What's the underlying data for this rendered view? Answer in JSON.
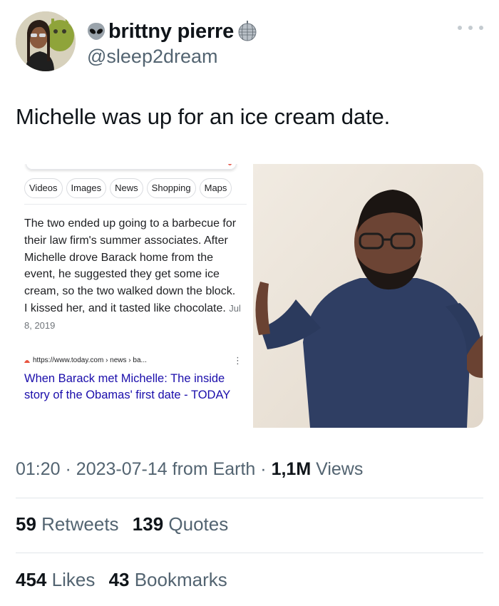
{
  "author": {
    "name": "brittny pierre",
    "handle": "@sleep2dream",
    "name_prefix_icon": "alien-icon",
    "name_suffix_icon": "disco-ball-icon"
  },
  "tweet": {
    "text": "Michelle was up for an ice cream date."
  },
  "google_result": {
    "chips": [
      "Videos",
      "Images",
      "News",
      "Shopping",
      "Maps"
    ],
    "snippet": "The two ended up going to a barbecue for their law firm's summer associates. After Michelle drove Barack home from the event, he suggested they get some ice cream, so the two walked down the block. I kissed her, and it tasted like chocolate.",
    "date": "Jul 8, 2019",
    "url": "https://www.today.com › news › ba...",
    "title": "When Barack met Michelle: The inside story of the Obamas' first date - TODAY"
  },
  "meta": {
    "time": "01:20",
    "date": "2023-07-14",
    "source": "from Earth",
    "views_count": "1,1M",
    "views_label": "Views"
  },
  "stats": {
    "retweets_count": "59",
    "retweets_label": "Retweets",
    "quotes_count": "139",
    "quotes_label": "Quotes",
    "likes_count": "454",
    "likes_label": "Likes",
    "bookmarks_count": "43",
    "bookmarks_label": "Bookmarks"
  },
  "colors": {
    "text_primary": "#0f1419",
    "text_secondary": "#536471",
    "link_blue": "#1a0dab",
    "divider": "#e1e6ea"
  }
}
